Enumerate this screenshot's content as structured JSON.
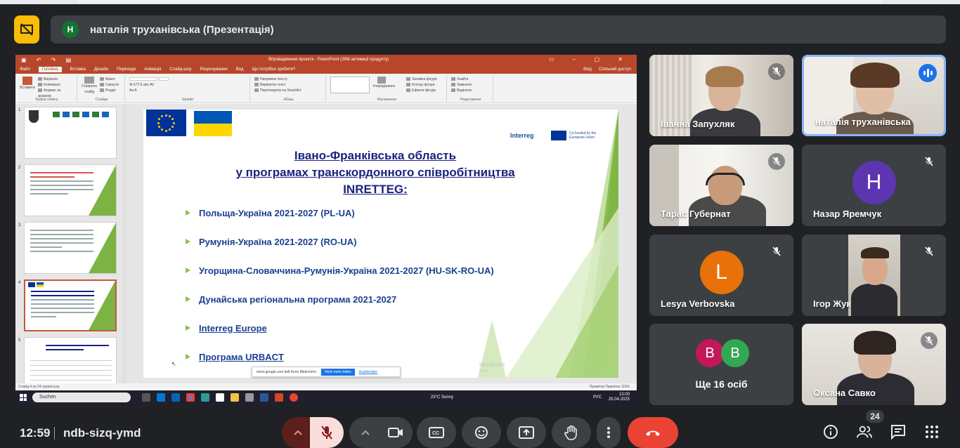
{
  "presenter_banner": {
    "avatar_initial": "Н",
    "text": "наталія труханівська (Презентація)"
  },
  "powerpoint": {
    "title": "Впровадження проєкта - PowerPoint (Збій активації продукту)",
    "tabs": [
      "Файл",
      "Головна",
      "Вставка",
      "Дизайн",
      "Переходи",
      "Анімація",
      "Слайд-шоу",
      "Рецензування",
      "Вид",
      "Що потрібно зробити?"
    ],
    "tabs_right": [
      "Вхід",
      "Спільний доступ"
    ],
    "ribbon_groups": [
      {
        "label": "Буфер обміну",
        "items": [
          "Вирізати",
          "Копіювати",
          "Формат за зразком"
        ],
        "main": "Вставити"
      },
      {
        "label": "Слайди",
        "items": [
          "Макет",
          "Скинути",
          "Розділ"
        ],
        "main": "Створити слайд"
      },
      {
        "label": "Шрифт",
        "items": [
          "Ж  К  П  S  abc  AV",
          "Aa  A"
        ],
        "main": ""
      },
      {
        "label": "Абзац",
        "items": [
          "Напрямок тексту",
          "Вирівняти текст",
          "Перетворити на SmartArt"
        ],
        "main": ""
      },
      {
        "label": "Малювання",
        "items": [
          "Заливка фігури",
          "Контур фігури",
          "Ефекти фігури"
        ],
        "main": "Упорядкувати"
      },
      {
        "label": "Редагування",
        "items": [
          "Знайти",
          "Замінити",
          "Виділити"
        ],
        "main": ""
      }
    ],
    "slide_numbers": [
      "1",
      "2",
      "3",
      "4",
      "5"
    ],
    "slide": {
      "title_line1": "Івано-Франківська область",
      "title_line2": "у програмах транскордонного співробітництва",
      "title_line3": "INRETTEG:",
      "interreg": "Interreg",
      "cofunded": "Co-funded by the European Union",
      "bullets": [
        {
          "text": "Польща-Україна 2021-2027 (PL-UA)",
          "link": false
        },
        {
          "text": "Румунія-Україна 2021-2027 (RO-UA)",
          "link": false
        },
        {
          "text": "Угорщина-Словаччина-Румунія-Україна 2021-2027 (HU-SK-RO-UA)",
          "link": false
        },
        {
          "text": "Дунайська регіональна програма 2021-2027",
          "link": false
        },
        {
          "text": "Interreg Europe",
          "link": true
        },
        {
          "text": "Програма URBACT",
          "link": true
        }
      ],
      "activation_line1": "Windows",
      "activation_line2": "Wec"
    },
    "toast": {
      "text": "meet.google.com teilt Ihren Bildschirm.",
      "button": "Nicht mehr teilen",
      "link": "Ausblenden"
    },
    "status_left": "Слайд 4 из 24    українська",
    "status_right": "Примітки    Примітки          115%",
    "taskbar": {
      "search": "Suchen",
      "weather": "23°C  Sunny",
      "clock_time": "13:00",
      "clock_date": "25.04.2025",
      "lang": "РУС"
    }
  },
  "participants": [
    {
      "name": "Іванна Запухляк",
      "muted": true,
      "type": "video"
    },
    {
      "name": "наталія труханівська",
      "muted": false,
      "speaking": true,
      "type": "video"
    },
    {
      "name": "Тарас Губернат",
      "muted": true,
      "type": "video"
    },
    {
      "name": "Назар Яремчук",
      "muted": true,
      "type": "avatar",
      "initial": "H",
      "color": "#5e35b1"
    },
    {
      "name": "Lesya Verbovska",
      "muted": true,
      "type": "avatar",
      "initial": "L",
      "color": "#e8710a"
    },
    {
      "name": "Ігор Жук",
      "muted": true,
      "type": "video"
    },
    {
      "name": "Ще 16 осіб",
      "type": "more",
      "initials": [
        "B",
        "B"
      ],
      "colors": [
        "#c2185b",
        "#33a852"
      ]
    },
    {
      "name": "Оксана Савко",
      "muted": true,
      "type": "video"
    }
  ],
  "bottom_bar": {
    "time": "12:59",
    "meeting_code": "ndb-sizq-ymd",
    "people_count": "24"
  },
  "colors": {
    "background": "#202124",
    "tile": "#3c4043",
    "accent": "#8ab4f8",
    "hangup": "#ea4335",
    "warning": "#fbbc04"
  }
}
